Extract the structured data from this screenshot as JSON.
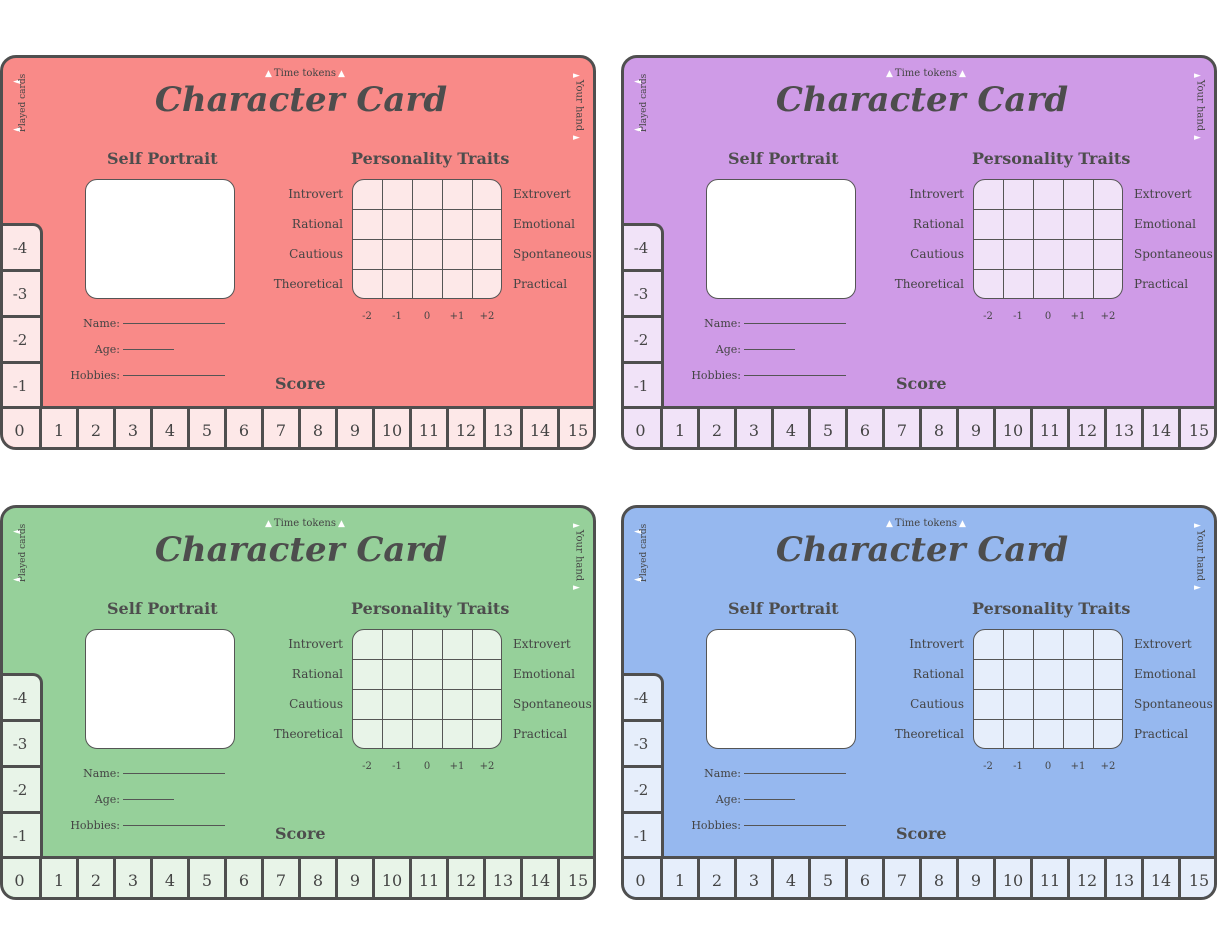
{
  "card": {
    "title": "Character Card",
    "time_tokens": "Time tokens",
    "played_cards": "Played cards",
    "your_hand": "Your hand",
    "self_portrait": "Self Portrait",
    "personality_traits": "Personality Traits",
    "traits_left": [
      "Introvert",
      "Rational",
      "Cautious",
      "Theoretical"
    ],
    "traits_right": [
      "Extrovert",
      "Emotional",
      "Spontaneous",
      "Practical"
    ],
    "axis": [
      "-2",
      "-1",
      "0",
      "+1",
      "+2"
    ],
    "fields": [
      "Name:",
      "Age:",
      "Hobbies:"
    ],
    "score": "Score",
    "negative_track": [
      "-4",
      "-3",
      "-2",
      "-1"
    ],
    "score_track": [
      "0",
      "1",
      "2",
      "3",
      "4",
      "5",
      "6",
      "7",
      "8",
      "9",
      "10",
      "11",
      "12",
      "13",
      "14",
      "15"
    ]
  },
  "cards": [
    {
      "color": "red",
      "bg": "#f98a88",
      "cell_bg": "#fde8e8"
    },
    {
      "color": "purple",
      "bg": "#cf9be7",
      "cell_bg": "#f1e3f8"
    },
    {
      "color": "green",
      "bg": "#96d09a",
      "cell_bg": "#e8f4e8"
    },
    {
      "color": "blue",
      "bg": "#96b8ef",
      "cell_bg": "#e6eefb"
    }
  ]
}
